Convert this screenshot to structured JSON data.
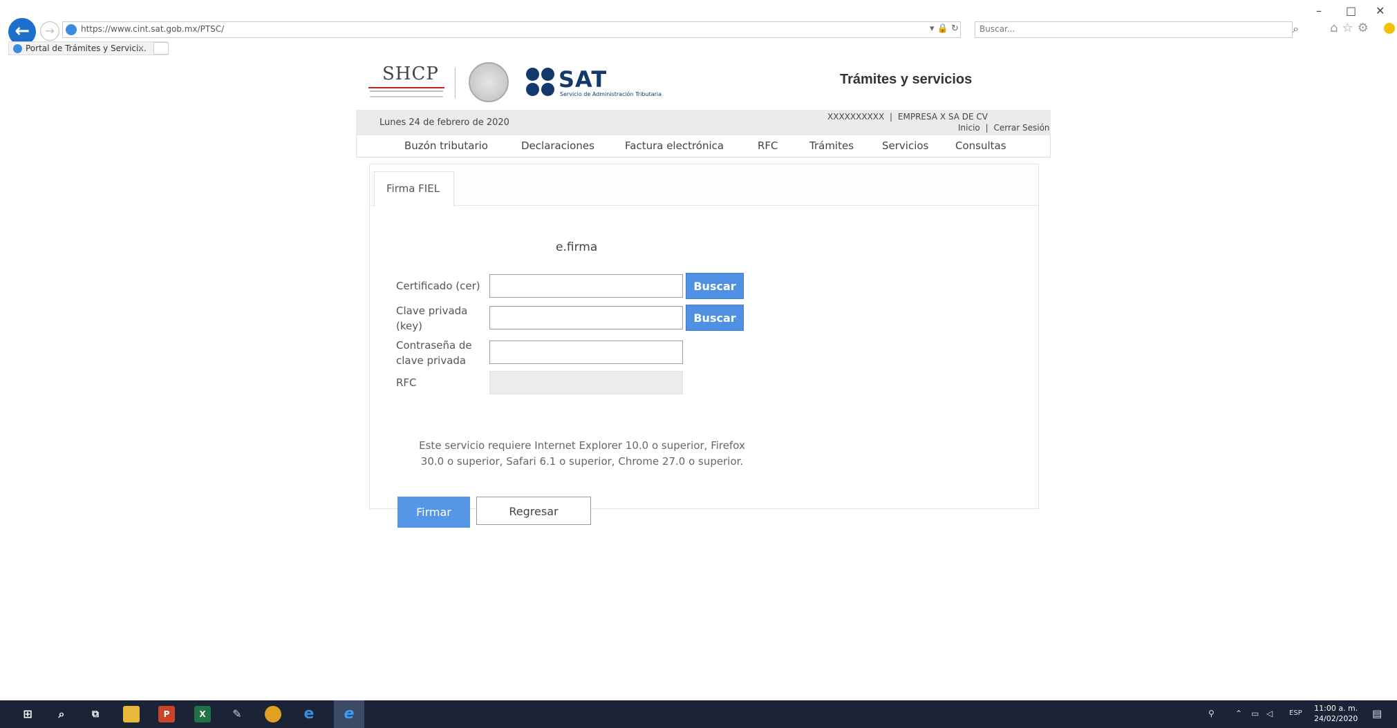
{
  "browser": {
    "url": "https://www.cint.sat.gob.mx/PTSC/",
    "search_placeholder": "Buscar...",
    "tab_title": "Portal de Trámites y Servici...",
    "addr_tools": "▾ 🔒 ↻",
    "window_controls": [
      "–",
      "□",
      "✕"
    ]
  },
  "header": {
    "shcp": "SHCP",
    "sat_word": "SAT",
    "sat_sub": "Servicio de Administración Tributaria",
    "title": "Trámites y servicios"
  },
  "infobar": {
    "date": "Lunes 24 de febrero de 2020",
    "rfc_user": "XXXXXXXXXX",
    "company": "EMPRESA X SA DE CV",
    "separator": "|",
    "inicio": "Inicio",
    "cerrar": "Cerrar Sesión"
  },
  "menu": [
    "Buzón tributario",
    "Declaraciones",
    "Factura electrónica",
    "RFC",
    "Trámites",
    "Servicios",
    "Consultas"
  ],
  "form": {
    "tab": "Firma FIEL",
    "heading": "e.firma",
    "cert_label": "Certificado (cer)",
    "key_label_1": "Clave privada",
    "key_label_2": "(key)",
    "pass_label_1": "Contraseña de",
    "pass_label_2": "clave privada",
    "rfc_label": "RFC",
    "buscar": "Buscar",
    "requirement_1": "Este servicio requiere Internet Explorer 10.0 o superior, Firefox",
    "requirement_2": "30.0 o superior, Safari 6.1 o superior, Chrome 27.0 o superior.",
    "firmar": "Firmar",
    "regresar": "Regresar"
  },
  "taskbar": {
    "lang": "ESP",
    "time": "11:00 a. m.",
    "date": "24/02/2020"
  }
}
